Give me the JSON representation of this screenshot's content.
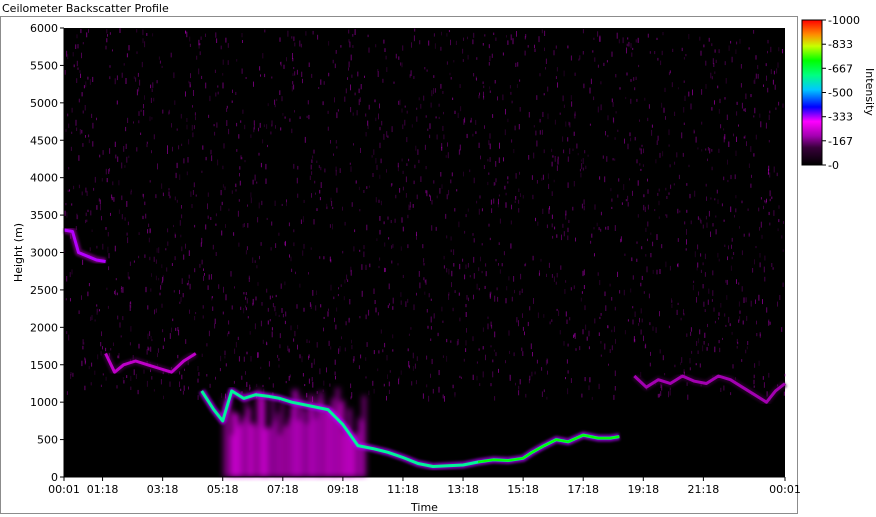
{
  "chart_data": {
    "type": "heatmap",
    "title": "Ceilometer Backscatter Profile",
    "xlabel": "Time",
    "ylabel": "Height (m)",
    "x_ticks": [
      "00:01",
      "01:18",
      "03:18",
      "05:18",
      "07:18",
      "09:18",
      "11:18",
      "13:18",
      "15:18",
      "17:18",
      "19:18",
      "21:18",
      "00:01"
    ],
    "x_tick_hours": [
      0.0167,
      1.3,
      3.3,
      5.3,
      7.3,
      9.3,
      11.3,
      13.3,
      15.3,
      17.3,
      19.3,
      21.3,
      24.0167
    ],
    "y_ticks": [
      0,
      500,
      1000,
      1500,
      2000,
      2500,
      3000,
      3500,
      4000,
      4500,
      5000,
      5500,
      6000
    ],
    "ylim": [
      0,
      6000
    ],
    "xlim_hours": [
      0.0167,
      24.0167
    ],
    "colorbar": {
      "label": "Intensity",
      "ticks": [
        1000,
        833,
        667,
        500,
        333,
        167,
        0
      ],
      "range": [
        0,
        1000
      ]
    },
    "layers": [
      {
        "name": "upper-layer",
        "points": [
          [
            0.0167,
            3300
          ],
          [
            0.3,
            3280
          ],
          [
            0.5,
            3000
          ],
          [
            0.8,
            2950
          ],
          [
            1.1,
            2900
          ],
          [
            1.4,
            2880
          ]
        ],
        "intensity": 330
      },
      {
        "name": "mid-layer-morning",
        "points": [
          [
            1.4,
            1650
          ],
          [
            1.7,
            1400
          ],
          [
            2.0,
            1500
          ],
          [
            2.4,
            1550
          ],
          [
            2.8,
            1500
          ],
          [
            3.2,
            1450
          ],
          [
            3.6,
            1400
          ],
          [
            4.0,
            1550
          ],
          [
            4.4,
            1650
          ]
        ],
        "intensity": 230
      },
      {
        "name": "boundary-layer",
        "points": [
          [
            4.6,
            1150
          ],
          [
            5.0,
            900
          ],
          [
            5.3,
            750
          ],
          [
            5.6,
            1150
          ],
          [
            6.0,
            1050
          ],
          [
            6.4,
            1100
          ],
          [
            6.8,
            1080
          ],
          [
            7.2,
            1050
          ],
          [
            7.6,
            1000
          ],
          [
            8.2,
            950
          ],
          [
            8.8,
            900
          ],
          [
            9.3,
            700
          ],
          [
            9.8,
            420
          ],
          [
            10.3,
            380
          ],
          [
            10.8,
            330
          ],
          [
            11.3,
            260
          ],
          [
            11.8,
            180
          ],
          [
            12.3,
            140
          ],
          [
            12.8,
            150
          ],
          [
            13.3,
            160
          ],
          [
            13.8,
            200
          ],
          [
            14.3,
            230
          ],
          [
            14.8,
            220
          ],
          [
            15.3,
            250
          ],
          [
            15.6,
            330
          ],
          [
            16.0,
            420
          ],
          [
            16.4,
            500
          ],
          [
            16.8,
            470
          ],
          [
            17.3,
            560
          ],
          [
            17.8,
            520
          ],
          [
            18.2,
            520
          ],
          [
            18.5,
            540
          ]
        ],
        "intensity": 600
      },
      {
        "name": "evening-layer",
        "points": [
          [
            19.0,
            1350
          ],
          [
            19.4,
            1200
          ],
          [
            19.8,
            1300
          ],
          [
            20.2,
            1250
          ],
          [
            20.6,
            1350
          ],
          [
            21.0,
            1280
          ],
          [
            21.4,
            1250
          ],
          [
            21.8,
            1350
          ],
          [
            22.2,
            1300
          ],
          [
            22.6,
            1200
          ],
          [
            23.0,
            1100
          ],
          [
            23.4,
            1000
          ],
          [
            23.7,
            1150
          ],
          [
            24.0167,
            1250
          ]
        ],
        "intensity": 200
      }
    ],
    "convective_plume": {
      "start_hour": 5.3,
      "end_hour": 10.0,
      "top_height": 1200,
      "intensity": 230
    }
  }
}
